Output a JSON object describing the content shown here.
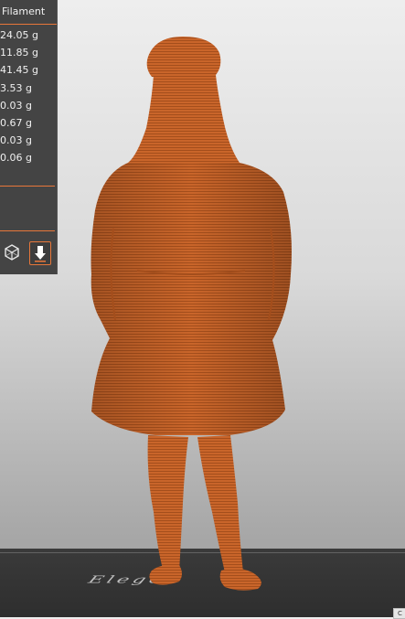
{
  "panel": {
    "header": "Filament",
    "rows": [
      "24.05 g",
      "11.85 g",
      "41.45 g",
      "3.53 g",
      "0.03 g",
      "0.67 g",
      "0.03 g",
      "0.06 g"
    ]
  },
  "icons": {
    "view_cube": "cube-icon",
    "export": "download-icon"
  },
  "colors": {
    "accent": "#e8773a",
    "model": "#c9652a",
    "panel_bg": "#444444"
  },
  "plate": {
    "logo": "Elegoo"
  },
  "corner_button_label": "C"
}
